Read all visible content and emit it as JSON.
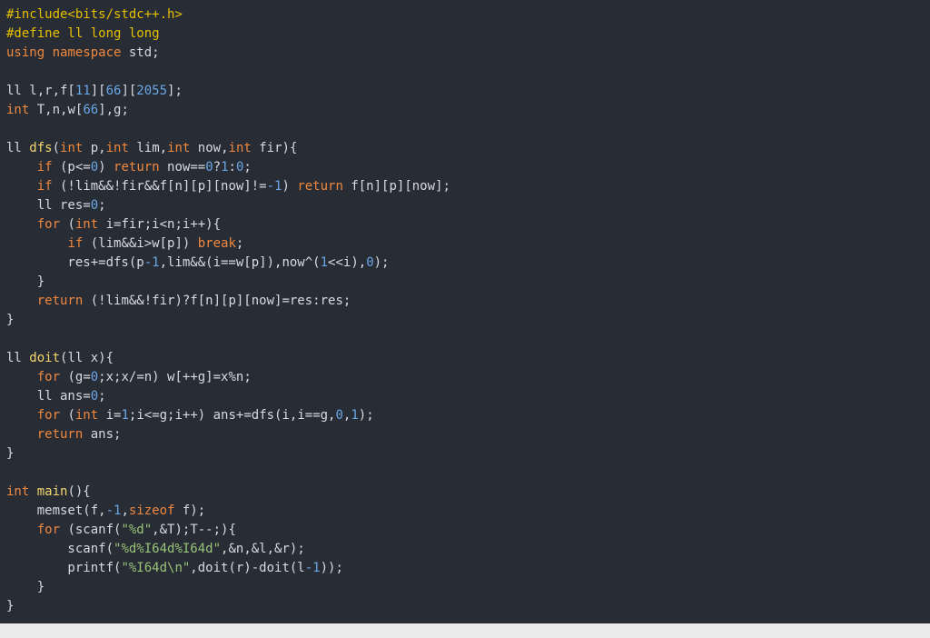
{
  "colors": {
    "background": "#282c34",
    "plain": "#d7dae0",
    "preprocessor": "#e5c000",
    "keyword": "#f0883e",
    "number": "#6aa7e6",
    "function": "#f5d76e",
    "string": "#98c379"
  },
  "code": {
    "lines": [
      [
        [
          "pp",
          "#include<bits/stdc++.h>"
        ]
      ],
      [
        [
          "pp",
          "#define ll long long"
        ]
      ],
      [
        [
          "kw",
          "using"
        ],
        [
          "pl",
          " "
        ],
        [
          "kw",
          "namespace"
        ],
        [
          "pl",
          " std;"
        ]
      ],
      [],
      [
        [
          "pl",
          "ll l,r,f["
        ],
        [
          "num",
          "11"
        ],
        [
          "pl",
          "]["
        ],
        [
          "num",
          "66"
        ],
        [
          "pl",
          "]["
        ],
        [
          "num",
          "2055"
        ],
        [
          "pl",
          "];"
        ]
      ],
      [
        [
          "kw",
          "int"
        ],
        [
          "pl",
          " T,n,w["
        ],
        [
          "num",
          "66"
        ],
        [
          "pl",
          "],g;"
        ]
      ],
      [],
      [
        [
          "pl",
          "ll "
        ],
        [
          "fn",
          "dfs"
        ],
        [
          "pl",
          "("
        ],
        [
          "kw",
          "int"
        ],
        [
          "pl",
          " p,"
        ],
        [
          "kw",
          "int"
        ],
        [
          "pl",
          " lim,"
        ],
        [
          "kw",
          "int"
        ],
        [
          "pl",
          " now,"
        ],
        [
          "kw",
          "int"
        ],
        [
          "pl",
          " fir){"
        ]
      ],
      [
        [
          "pl",
          "    "
        ],
        [
          "kw",
          "if"
        ],
        [
          "pl",
          " (p<="
        ],
        [
          "num",
          "0"
        ],
        [
          "pl",
          ") "
        ],
        [
          "kw",
          "return"
        ],
        [
          "pl",
          " now=="
        ],
        [
          "num",
          "0"
        ],
        [
          "pl",
          "?"
        ],
        [
          "num",
          "1"
        ],
        [
          "pl",
          ":"
        ],
        [
          "num",
          "0"
        ],
        [
          "pl",
          ";"
        ]
      ],
      [
        [
          "pl",
          "    "
        ],
        [
          "kw",
          "if"
        ],
        [
          "pl",
          " (!lim&&!fir&&f[n][p][now]!="
        ],
        [
          "num",
          "-1"
        ],
        [
          "pl",
          ") "
        ],
        [
          "kw",
          "return"
        ],
        [
          "pl",
          " f[n][p][now];"
        ]
      ],
      [
        [
          "pl",
          "    ll res="
        ],
        [
          "num",
          "0"
        ],
        [
          "pl",
          ";"
        ]
      ],
      [
        [
          "pl",
          "    "
        ],
        [
          "kw",
          "for"
        ],
        [
          "pl",
          " ("
        ],
        [
          "kw",
          "int"
        ],
        [
          "pl",
          " i=fir;i<n;i++){"
        ]
      ],
      [
        [
          "pl",
          "        "
        ],
        [
          "kw",
          "if"
        ],
        [
          "pl",
          " (lim&&i>w[p]) "
        ],
        [
          "kw",
          "break"
        ],
        [
          "pl",
          ";"
        ]
      ],
      [
        [
          "pl",
          "        res+=dfs(p"
        ],
        [
          "num",
          "-1"
        ],
        [
          "pl",
          ",lim&&(i==w[p]),now^("
        ],
        [
          "num",
          "1"
        ],
        [
          "pl",
          "<<i),"
        ],
        [
          "num",
          "0"
        ],
        [
          "pl",
          ");"
        ]
      ],
      [
        [
          "pl",
          "    }"
        ]
      ],
      [
        [
          "pl",
          "    "
        ],
        [
          "kw",
          "return"
        ],
        [
          "pl",
          " (!lim&&!fir)?f[n][p][now]=res:res;"
        ]
      ],
      [
        [
          "pl",
          "}"
        ]
      ],
      [],
      [
        [
          "pl",
          "ll "
        ],
        [
          "fn",
          "doit"
        ],
        [
          "pl",
          "(ll x){"
        ]
      ],
      [
        [
          "pl",
          "    "
        ],
        [
          "kw",
          "for"
        ],
        [
          "pl",
          " (g="
        ],
        [
          "num",
          "0"
        ],
        [
          "pl",
          ";x;x/=n) w[++g]=x%n;"
        ]
      ],
      [
        [
          "pl",
          "    ll ans="
        ],
        [
          "num",
          "0"
        ],
        [
          "pl",
          ";"
        ]
      ],
      [
        [
          "pl",
          "    "
        ],
        [
          "kw",
          "for"
        ],
        [
          "pl",
          " ("
        ],
        [
          "kw",
          "int"
        ],
        [
          "pl",
          " i="
        ],
        [
          "num",
          "1"
        ],
        [
          "pl",
          ";i<=g;i++) ans+=dfs(i,i==g,"
        ],
        [
          "num",
          "0"
        ],
        [
          "pl",
          ","
        ],
        [
          "num",
          "1"
        ],
        [
          "pl",
          ");"
        ]
      ],
      [
        [
          "pl",
          "    "
        ],
        [
          "kw",
          "return"
        ],
        [
          "pl",
          " ans;"
        ]
      ],
      [
        [
          "pl",
          "}"
        ]
      ],
      [],
      [
        [
          "kw",
          "int"
        ],
        [
          "pl",
          " "
        ],
        [
          "fn",
          "main"
        ],
        [
          "pl",
          "(){"
        ]
      ],
      [
        [
          "pl",
          "    memset(f,"
        ],
        [
          "num",
          "-1"
        ],
        [
          "pl",
          ","
        ],
        [
          "kw",
          "sizeof"
        ],
        [
          "pl",
          " f);"
        ]
      ],
      [
        [
          "pl",
          "    "
        ],
        [
          "kw",
          "for"
        ],
        [
          "pl",
          " (scanf("
        ],
        [
          "str",
          "\"%d\""
        ],
        [
          "pl",
          ",&T);T--;){"
        ]
      ],
      [
        [
          "pl",
          "        scanf("
        ],
        [
          "str",
          "\"%d%I64d%I64d\""
        ],
        [
          "pl",
          ",&n,&l,&r);"
        ]
      ],
      [
        [
          "pl",
          "        printf("
        ],
        [
          "str",
          "\"%I64d\\n\""
        ],
        [
          "pl",
          ",doit(r)-doit(l"
        ],
        [
          "num",
          "-1"
        ],
        [
          "pl",
          "));"
        ]
      ],
      [
        [
          "pl",
          "    }"
        ]
      ],
      [
        [
          "pl",
          "}"
        ]
      ]
    ]
  }
}
